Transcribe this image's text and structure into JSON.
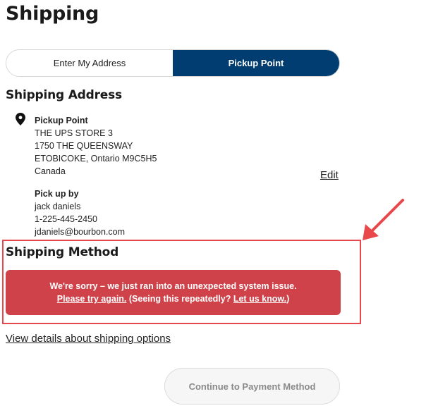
{
  "page": {
    "title": "Shipping"
  },
  "toggle": {
    "enter_address_label": "Enter My Address",
    "pickup_point_label": "Pickup Point",
    "selected": "Pickup Point"
  },
  "shipping_address": {
    "heading": "Shipping Address",
    "pickup_label": "Pickup Point",
    "store_name": "THE UPS STORE 3",
    "street": "1750 THE QUEENSWAY",
    "city_line": "ETOBICOKE, Ontario M9C5H5",
    "country": "Canada",
    "pickup_by_label": "Pick up by",
    "name": "jack daniels",
    "phone": "1-225-445-2450",
    "email": "jdaniels@bourbon.com",
    "edit_label": "Edit"
  },
  "shipping_method": {
    "heading": "Shipping Method",
    "error_line1": "We're sorry – we just ran into an unexpected system issue.",
    "error_try_again": "Please try again.",
    "error_mid": " (Seeing this repeatedly? ",
    "error_let_us_know": "Let us know.",
    "error_end": ")"
  },
  "links": {
    "view_details": "View details about shipping options"
  },
  "buttons": {
    "continue": "Continue to Payment Method"
  },
  "colors": {
    "active_toggle": "#013d70",
    "error_bg": "#d0424a",
    "annotation": "#e8474b"
  },
  "icons": {
    "location": "map-pin-icon",
    "annotation_arrow": "arrow-icon"
  }
}
